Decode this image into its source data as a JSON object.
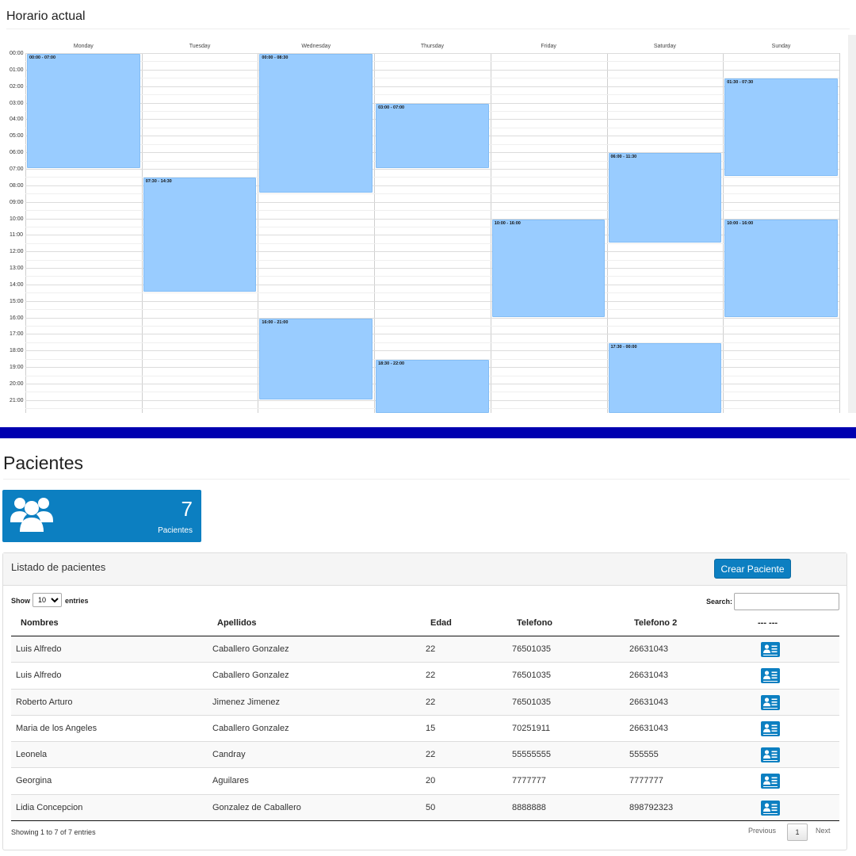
{
  "schedule": {
    "title": "Horario actual",
    "days": [
      "Monday",
      "Tuesday",
      "Wednesday",
      "Thursday",
      "Friday",
      "Saturday",
      "Sunday"
    ],
    "hours": [
      "00:00",
      "01:00",
      "02:00",
      "03:00",
      "04:00",
      "05:00",
      "06:00",
      "07:00",
      "08:00",
      "09:00",
      "10:00",
      "11:00",
      "12:00",
      "13:00",
      "14:00",
      "15:00",
      "16:00",
      "17:00",
      "18:00",
      "19:00",
      "20:00",
      "21:00"
    ],
    "events": [
      {
        "day": 0,
        "start": 0,
        "end": 7,
        "label": "00:00 - 07:00"
      },
      {
        "day": 1,
        "start": 7.5,
        "end": 14.5,
        "label": "07:30 - 14:30"
      },
      {
        "day": 2,
        "start": 0,
        "end": 8.5,
        "label": "00:00 - 08:30"
      },
      {
        "day": 2,
        "start": 16,
        "end": 21,
        "label": "16:00 - 21:00"
      },
      {
        "day": 3,
        "start": 3,
        "end": 7,
        "label": "03:00 - 07:00"
      },
      {
        "day": 3,
        "start": 18.5,
        "end": 22,
        "label": "18:30 - 22:00"
      },
      {
        "day": 4,
        "start": 10,
        "end": 16,
        "label": "10:00 - 16:00"
      },
      {
        "day": 5,
        "start": 6,
        "end": 11.5,
        "label": "06:00 - 11:30"
      },
      {
        "day": 5,
        "start": 17.5,
        "end": 24,
        "label": "17:30 - 00:00"
      },
      {
        "day": 6,
        "start": 1.5,
        "end": 7.5,
        "label": "01:30 - 07:30"
      },
      {
        "day": 6,
        "start": 10,
        "end": 16,
        "label": "10:00 - 16:00"
      }
    ],
    "event_color": "#99ccff"
  },
  "patients": {
    "title": "Pacientes",
    "stat": {
      "count": "7",
      "label": "Pacientes",
      "icon": "users-icon",
      "color": "#0c7fc1"
    },
    "panel": {
      "title": "Listado de pacientes",
      "create_label": "Crear Paciente",
      "length": {
        "show_label": "Show",
        "selected": "10",
        "entries_label": "entries"
      },
      "search_label": "Search:",
      "columns": [
        "Nombres",
        "Apellidos",
        "Edad",
        "Telefono",
        "Telefono 2",
        "--- ---"
      ],
      "rows": [
        [
          "Luis Alfredo",
          "Caballero Gonzalez",
          "22",
          "76501035",
          "26631043"
        ],
        [
          "Luis Alfredo",
          "Caballero Gonzalez",
          "22",
          "76501035",
          "26631043"
        ],
        [
          "Roberto Arturo",
          "Jimenez Jimenez",
          "22",
          "76501035",
          "26631043"
        ],
        [
          "Maria de los Angeles",
          "Caballero Gonzalez",
          "15",
          "70251911",
          "26631043"
        ],
        [
          "Leonela",
          "Candray",
          "22",
          "55555555",
          "555555"
        ],
        [
          "Georgina",
          "Aguilares",
          "20",
          "7777777",
          "7777777"
        ],
        [
          "Lidia Concepcion",
          "Gonzalez de Caballero",
          "50",
          "8888888",
          "898792323"
        ]
      ],
      "row_action_icon": "patient-card-icon",
      "info": "Showing 1 to 7 of 7 entries",
      "pagination": {
        "previous": "Previous",
        "current": "1",
        "next": "Next"
      }
    }
  },
  "divider_color": "#0000b0"
}
